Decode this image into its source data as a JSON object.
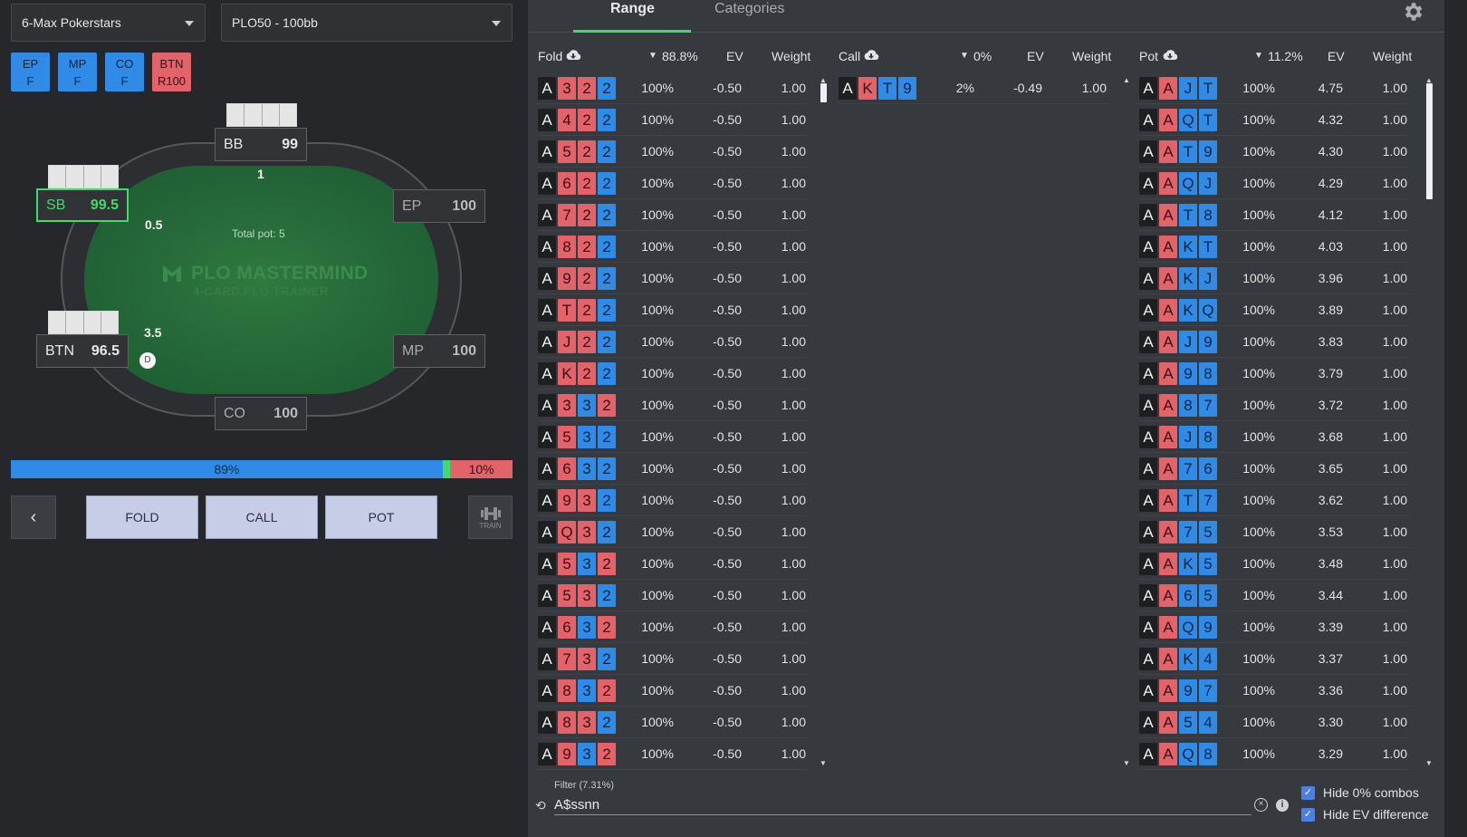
{
  "header": {
    "game_select": "6-Max Pokerstars",
    "stakes_select": "PLO50 - 100bb"
  },
  "history": [
    {
      "pos": "EP",
      "act": "F",
      "color": "#2f8be6"
    },
    {
      "pos": "MP",
      "act": "F",
      "color": "#2f8be6"
    },
    {
      "pos": "CO",
      "act": "F",
      "color": "#2f8be6"
    },
    {
      "pos": "BTN",
      "act": "R100",
      "color": "#e2636a"
    }
  ],
  "table": {
    "total_pot": "Total pot: 5",
    "logo": "PLO MASTERMIND",
    "logo_sub": "4-CARD PLO TRAINER",
    "dealer": "D",
    "seats": {
      "bb": {
        "pos": "BB",
        "stack": "99",
        "bet": "1"
      },
      "sb": {
        "pos": "SB",
        "stack": "99.5",
        "bet": "0.5"
      },
      "ep": {
        "pos": "EP",
        "stack": "100"
      },
      "btn": {
        "pos": "BTN",
        "stack": "96.5",
        "bet": "3.5"
      },
      "mp": {
        "pos": "MP",
        "stack": "100"
      },
      "co": {
        "pos": "CO",
        "stack": "100"
      }
    }
  },
  "freq": {
    "fold_label": "89%",
    "pot_label": "10%",
    "fold": 0.886,
    "call": 0.0,
    "pot": 0.112
  },
  "actions": {
    "back": "‹",
    "fold": "FOLD",
    "call": "CALL",
    "pot": "POT",
    "train": "TRAIN"
  },
  "tabs": {
    "range": "Range",
    "categories": "Categories"
  },
  "columns": {
    "fold": {
      "title": "Fold",
      "pct": "88.8%",
      "ev": "EV",
      "weight": "Weight"
    },
    "call": {
      "title": "Call",
      "pct": "0%",
      "ev": "EV",
      "weight": "Weight"
    },
    "pot": {
      "title": "Pot",
      "pct": "11.2%",
      "ev": "EV",
      "weight": "Weight"
    }
  },
  "fold_rows": [
    {
      "cards": [
        [
          "A",
          "s"
        ],
        [
          "3",
          "h"
        ],
        [
          "2",
          "h"
        ],
        [
          "2",
          "d"
        ]
      ],
      "freq": "100%",
      "ev": "-0.50",
      "w": "1.00"
    },
    {
      "cards": [
        [
          "A",
          "s"
        ],
        [
          "4",
          "h"
        ],
        [
          "2",
          "h"
        ],
        [
          "2",
          "d"
        ]
      ],
      "freq": "100%",
      "ev": "-0.50",
      "w": "1.00"
    },
    {
      "cards": [
        [
          "A",
          "s"
        ],
        [
          "5",
          "h"
        ],
        [
          "2",
          "h"
        ],
        [
          "2",
          "d"
        ]
      ],
      "freq": "100%",
      "ev": "-0.50",
      "w": "1.00"
    },
    {
      "cards": [
        [
          "A",
          "s"
        ],
        [
          "6",
          "h"
        ],
        [
          "2",
          "h"
        ],
        [
          "2",
          "d"
        ]
      ],
      "freq": "100%",
      "ev": "-0.50",
      "w": "1.00"
    },
    {
      "cards": [
        [
          "A",
          "s"
        ],
        [
          "7",
          "h"
        ],
        [
          "2",
          "h"
        ],
        [
          "2",
          "d"
        ]
      ],
      "freq": "100%",
      "ev": "-0.50",
      "w": "1.00"
    },
    {
      "cards": [
        [
          "A",
          "s"
        ],
        [
          "8",
          "h"
        ],
        [
          "2",
          "h"
        ],
        [
          "2",
          "d"
        ]
      ],
      "freq": "100%",
      "ev": "-0.50",
      "w": "1.00"
    },
    {
      "cards": [
        [
          "A",
          "s"
        ],
        [
          "9",
          "h"
        ],
        [
          "2",
          "h"
        ],
        [
          "2",
          "d"
        ]
      ],
      "freq": "100%",
      "ev": "-0.50",
      "w": "1.00"
    },
    {
      "cards": [
        [
          "A",
          "s"
        ],
        [
          "T",
          "h"
        ],
        [
          "2",
          "h"
        ],
        [
          "2",
          "d"
        ]
      ],
      "freq": "100%",
      "ev": "-0.50",
      "w": "1.00"
    },
    {
      "cards": [
        [
          "A",
          "s"
        ],
        [
          "J",
          "h"
        ],
        [
          "2",
          "h"
        ],
        [
          "2",
          "d"
        ]
      ],
      "freq": "100%",
      "ev": "-0.50",
      "w": "1.00"
    },
    {
      "cards": [
        [
          "A",
          "s"
        ],
        [
          "K",
          "h"
        ],
        [
          "2",
          "h"
        ],
        [
          "2",
          "d"
        ]
      ],
      "freq": "100%",
      "ev": "-0.50",
      "w": "1.00"
    },
    {
      "cards": [
        [
          "A",
          "s"
        ],
        [
          "3",
          "h"
        ],
        [
          "3",
          "d"
        ],
        [
          "2",
          "h"
        ]
      ],
      "freq": "100%",
      "ev": "-0.50",
      "w": "1.00"
    },
    {
      "cards": [
        [
          "A",
          "s"
        ],
        [
          "5",
          "h"
        ],
        [
          "3",
          "d"
        ],
        [
          "2",
          "d"
        ]
      ],
      "freq": "100%",
      "ev": "-0.50",
      "w": "1.00"
    },
    {
      "cards": [
        [
          "A",
          "s"
        ],
        [
          "6",
          "h"
        ],
        [
          "3",
          "d"
        ],
        [
          "2",
          "d"
        ]
      ],
      "freq": "100%",
      "ev": "-0.50",
      "w": "1.00"
    },
    {
      "cards": [
        [
          "A",
          "s"
        ],
        [
          "9",
          "h"
        ],
        [
          "3",
          "h"
        ],
        [
          "2",
          "d"
        ]
      ],
      "freq": "100%",
      "ev": "-0.50",
      "w": "1.00"
    },
    {
      "cards": [
        [
          "A",
          "s"
        ],
        [
          "Q",
          "h"
        ],
        [
          "3",
          "h"
        ],
        [
          "2",
          "d"
        ]
      ],
      "freq": "100%",
      "ev": "-0.50",
      "w": "1.00"
    },
    {
      "cards": [
        [
          "A",
          "s"
        ],
        [
          "5",
          "h"
        ],
        [
          "3",
          "d"
        ],
        [
          "2",
          "h"
        ]
      ],
      "freq": "100%",
      "ev": "-0.50",
      "w": "1.00"
    },
    {
      "cards": [
        [
          "A",
          "s"
        ],
        [
          "5",
          "h"
        ],
        [
          "3",
          "h"
        ],
        [
          "2",
          "d"
        ]
      ],
      "freq": "100%",
      "ev": "-0.50",
      "w": "1.00"
    },
    {
      "cards": [
        [
          "A",
          "s"
        ],
        [
          "6",
          "h"
        ],
        [
          "3",
          "d"
        ],
        [
          "2",
          "h"
        ]
      ],
      "freq": "100%",
      "ev": "-0.50",
      "w": "1.00"
    },
    {
      "cards": [
        [
          "A",
          "s"
        ],
        [
          "7",
          "h"
        ],
        [
          "3",
          "h"
        ],
        [
          "2",
          "d"
        ]
      ],
      "freq": "100%",
      "ev": "-0.50",
      "w": "1.00"
    },
    {
      "cards": [
        [
          "A",
          "s"
        ],
        [
          "8",
          "h"
        ],
        [
          "3",
          "d"
        ],
        [
          "2",
          "h"
        ]
      ],
      "freq": "100%",
      "ev": "-0.50",
      "w": "1.00"
    },
    {
      "cards": [
        [
          "A",
          "s"
        ],
        [
          "8",
          "h"
        ],
        [
          "3",
          "h"
        ],
        [
          "2",
          "d"
        ]
      ],
      "freq": "100%",
      "ev": "-0.50",
      "w": "1.00"
    },
    {
      "cards": [
        [
          "A",
          "s"
        ],
        [
          "9",
          "h"
        ],
        [
          "3",
          "d"
        ],
        [
          "2",
          "h"
        ]
      ],
      "freq": "100%",
      "ev": "-0.50",
      "w": "1.00"
    }
  ],
  "call_rows": [
    {
      "cards": [
        [
          "A",
          "s"
        ],
        [
          "K",
          "h"
        ],
        [
          "T",
          "d"
        ],
        [
          "9",
          "d"
        ]
      ],
      "freq": "2%",
      "ev": "-0.49",
      "w": "1.00"
    }
  ],
  "pot_rows": [
    {
      "cards": [
        [
          "A",
          "s"
        ],
        [
          "A",
          "h"
        ],
        [
          "J",
          "d"
        ],
        [
          "T",
          "d"
        ]
      ],
      "freq": "100%",
      "ev": "4.75",
      "w": "1.00"
    },
    {
      "cards": [
        [
          "A",
          "s"
        ],
        [
          "A",
          "h"
        ],
        [
          "Q",
          "d"
        ],
        [
          "T",
          "d"
        ]
      ],
      "freq": "100%",
      "ev": "4.32",
      "w": "1.00"
    },
    {
      "cards": [
        [
          "A",
          "s"
        ],
        [
          "A",
          "h"
        ],
        [
          "T",
          "d"
        ],
        [
          "9",
          "d"
        ]
      ],
      "freq": "100%",
      "ev": "4.30",
      "w": "1.00"
    },
    {
      "cards": [
        [
          "A",
          "s"
        ],
        [
          "A",
          "h"
        ],
        [
          "Q",
          "d"
        ],
        [
          "J",
          "d"
        ]
      ],
      "freq": "100%",
      "ev": "4.29",
      "w": "1.00"
    },
    {
      "cards": [
        [
          "A",
          "s"
        ],
        [
          "A",
          "h"
        ],
        [
          "T",
          "d"
        ],
        [
          "8",
          "d"
        ]
      ],
      "freq": "100%",
      "ev": "4.12",
      "w": "1.00"
    },
    {
      "cards": [
        [
          "A",
          "s"
        ],
        [
          "A",
          "h"
        ],
        [
          "K",
          "d"
        ],
        [
          "T",
          "d"
        ]
      ],
      "freq": "100%",
      "ev": "4.03",
      "w": "1.00"
    },
    {
      "cards": [
        [
          "A",
          "s"
        ],
        [
          "A",
          "h"
        ],
        [
          "K",
          "d"
        ],
        [
          "J",
          "d"
        ]
      ],
      "freq": "100%",
      "ev": "3.96",
      "w": "1.00"
    },
    {
      "cards": [
        [
          "A",
          "s"
        ],
        [
          "A",
          "h"
        ],
        [
          "K",
          "d"
        ],
        [
          "Q",
          "d"
        ]
      ],
      "freq": "100%",
      "ev": "3.89",
      "w": "1.00"
    },
    {
      "cards": [
        [
          "A",
          "s"
        ],
        [
          "A",
          "h"
        ],
        [
          "J",
          "d"
        ],
        [
          "9",
          "d"
        ]
      ],
      "freq": "100%",
      "ev": "3.83",
      "w": "1.00"
    },
    {
      "cards": [
        [
          "A",
          "s"
        ],
        [
          "A",
          "h"
        ],
        [
          "9",
          "d"
        ],
        [
          "8",
          "d"
        ]
      ],
      "freq": "100%",
      "ev": "3.79",
      "w": "1.00"
    },
    {
      "cards": [
        [
          "A",
          "s"
        ],
        [
          "A",
          "h"
        ],
        [
          "8",
          "d"
        ],
        [
          "7",
          "d"
        ]
      ],
      "freq": "100%",
      "ev": "3.72",
      "w": "1.00"
    },
    {
      "cards": [
        [
          "A",
          "s"
        ],
        [
          "A",
          "h"
        ],
        [
          "J",
          "d"
        ],
        [
          "8",
          "d"
        ]
      ],
      "freq": "100%",
      "ev": "3.68",
      "w": "1.00"
    },
    {
      "cards": [
        [
          "A",
          "s"
        ],
        [
          "A",
          "h"
        ],
        [
          "7",
          "d"
        ],
        [
          "6",
          "d"
        ]
      ],
      "freq": "100%",
      "ev": "3.65",
      "w": "1.00"
    },
    {
      "cards": [
        [
          "A",
          "s"
        ],
        [
          "A",
          "h"
        ],
        [
          "T",
          "d"
        ],
        [
          "7",
          "d"
        ]
      ],
      "freq": "100%",
      "ev": "3.62",
      "w": "1.00"
    },
    {
      "cards": [
        [
          "A",
          "s"
        ],
        [
          "A",
          "h"
        ],
        [
          "7",
          "d"
        ],
        [
          "5",
          "d"
        ]
      ],
      "freq": "100%",
      "ev": "3.53",
      "w": "1.00"
    },
    {
      "cards": [
        [
          "A",
          "s"
        ],
        [
          "A",
          "h"
        ],
        [
          "K",
          "d"
        ],
        [
          "5",
          "d"
        ]
      ],
      "freq": "100%",
      "ev": "3.48",
      "w": "1.00"
    },
    {
      "cards": [
        [
          "A",
          "s"
        ],
        [
          "A",
          "h"
        ],
        [
          "6",
          "d"
        ],
        [
          "5",
          "d"
        ]
      ],
      "freq": "100%",
      "ev": "3.44",
      "w": "1.00"
    },
    {
      "cards": [
        [
          "A",
          "s"
        ],
        [
          "A",
          "h"
        ],
        [
          "Q",
          "d"
        ],
        [
          "9",
          "d"
        ]
      ],
      "freq": "100%",
      "ev": "3.39",
      "w": "1.00"
    },
    {
      "cards": [
        [
          "A",
          "s"
        ],
        [
          "A",
          "h"
        ],
        [
          "K",
          "d"
        ],
        [
          "4",
          "d"
        ]
      ],
      "freq": "100%",
      "ev": "3.37",
      "w": "1.00"
    },
    {
      "cards": [
        [
          "A",
          "s"
        ],
        [
          "A",
          "h"
        ],
        [
          "9",
          "d"
        ],
        [
          "7",
          "d"
        ]
      ],
      "freq": "100%",
      "ev": "3.36",
      "w": "1.00"
    },
    {
      "cards": [
        [
          "A",
          "s"
        ],
        [
          "A",
          "h"
        ],
        [
          "5",
          "d"
        ],
        [
          "4",
          "d"
        ]
      ],
      "freq": "100%",
      "ev": "3.30",
      "w": "1.00"
    },
    {
      "cards": [
        [
          "A",
          "s"
        ],
        [
          "A",
          "h"
        ],
        [
          "Q",
          "d"
        ],
        [
          "8",
          "d"
        ]
      ],
      "freq": "100%",
      "ev": "3.29",
      "w": "1.00"
    }
  ],
  "filter": {
    "label": "Filter (7.31%)",
    "value": "A$ssnn",
    "hide_zero": "Hide 0% combos",
    "hide_ev": "Hide EV difference"
  }
}
